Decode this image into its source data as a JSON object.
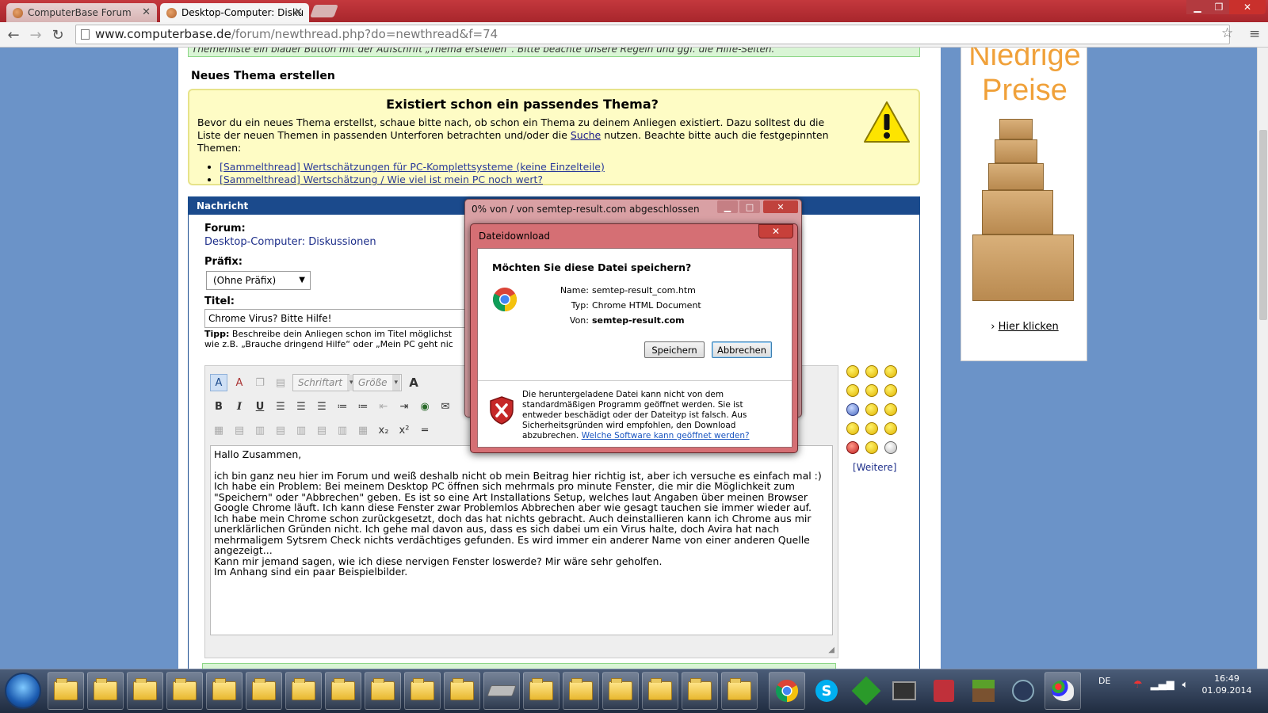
{
  "browser": {
    "tabs": [
      {
        "label": "ComputerBase Forum",
        "active": false
      },
      {
        "label": "Desktop-Computer: Disku",
        "active": true
      }
    ],
    "url_domain": "www.computerbase.de",
    "url_path": "/forum/newthread.php?do=newthread&f=74"
  },
  "page": {
    "green_strip_text": "Themenliste ein blauer Button mit der Aufschrift „Thema erstellen“. Bitte beachte unsere Regeln und ggf. die Hilfe-Seiten.",
    "title": "Neues Thema erstellen",
    "notice": {
      "heading": "Existiert schon ein passendes Thema?",
      "text_before_link": "Bevor du ein neues Thema erstellst, schaue bitte nach, ob schon ein Thema zu deinem Anliegen existiert. Dazu solltest du die Liste der neuen Themen in passenden Unterforen betrachten und/oder die ",
      "link": "Suche",
      "text_after_link": " nutzen. Beachte bitte auch die festgepinnten Themen:",
      "links": [
        "[Sammelthread] Wertschätzungen für PC-Komplettsysteme (keine Einzelteile)",
        "[Sammelthread] Wertschätzung / Wie viel ist mein PC noch wert?"
      ]
    },
    "message": {
      "header": "Nachricht",
      "forum_label": "Forum:",
      "forum_value": "Desktop-Computer: Diskussionen",
      "prefix_label": "Präfix:",
      "prefix_value": "(Ohne Präfix)",
      "title_label": "Titel:",
      "title_value": "Chrome Virus? Bitte Hilfe!",
      "tip_bold": "Tipp:",
      "tip_line1": " Beschreibe dein Anliegen schon im Titel möglichst",
      "tip_line2": "wie z.B. „Brauche dringend Hilfe“ oder „Mein PC geht nic",
      "font_select": "Schriftart",
      "size_select": "Größe",
      "body": [
        "Hallo Zusammen,",
        "",
        "ich bin ganz neu hier im Forum und weiß deshalb nicht ob mein Beitrag hier richtig ist, aber ich versuche es einfach mal :)",
        "Ich habe ein Problem: Bei meinem Desktop PC öffnen sich mehrmals pro minute Fenster, die mir die Möglichkeit zum \"Speichern\" oder \"Abbrechen\" geben. Es ist so eine Art Installations Setup, welches laut Angaben über meinen Browser Google Chrome läuft. Ich kann diese Fenster zwar Problemlos Abbrechen aber wie gesagt tauchen sie immer wieder auf. Ich habe mein Chrome schon zurückgesetzt, doch das hat nichts gebracht. Auch deinstallieren kann ich Chrome aus mir unerklärlichen Gründen nicht. Ich gehe mal davon aus, dass es sich dabei um ein Virus halte, doch Avira hat nach mehrmaligem Sytsrem Check nichts verdächtiges gefunden. Es wird immer ein anderer Name von einer anderen Quelle angezeigt...",
        "Kann mir jemand sagen, wie ich diese nervigen Fenster loswerde? Mir wäre sehr geholfen.",
        "Im Anhang sind ein paar Beispielbilder."
      ],
      "more_smilies": "[Weitere]"
    }
  },
  "ad": {
    "title_line1": "Niedrige",
    "title_line2": "Preise",
    "link": "Hier klicken",
    "accent": "#f0a13a"
  },
  "progress_dialog": {
    "title": "0% von / von semtep-result.com abgeschlossen"
  },
  "download_dialog": {
    "title": "Dateidownload",
    "question": "Möchten Sie diese Datei speichern?",
    "name_label": "Name:",
    "name_value": "semtep-result_com.htm",
    "type_label": "Typ:",
    "type_value": "Chrome HTML Document",
    "from_label": "Von:",
    "from_value": "semtep-result.com",
    "save_button": "Speichern",
    "cancel_button": "Abbrechen",
    "warning": "Die heruntergeladene Datei kann nicht von dem standardmäßigen Programm geöffnet werden. Sie ist entweder beschädigt oder der Dateityp ist falsch. Aus Sicherheitsgründen wird empfohlen, den Download abzubrechen. ",
    "warning_link": "Welche Software kann geöffnet werden?"
  },
  "taskbar": {
    "language": "DE",
    "time": "16:49",
    "date": "01.09.2014"
  }
}
